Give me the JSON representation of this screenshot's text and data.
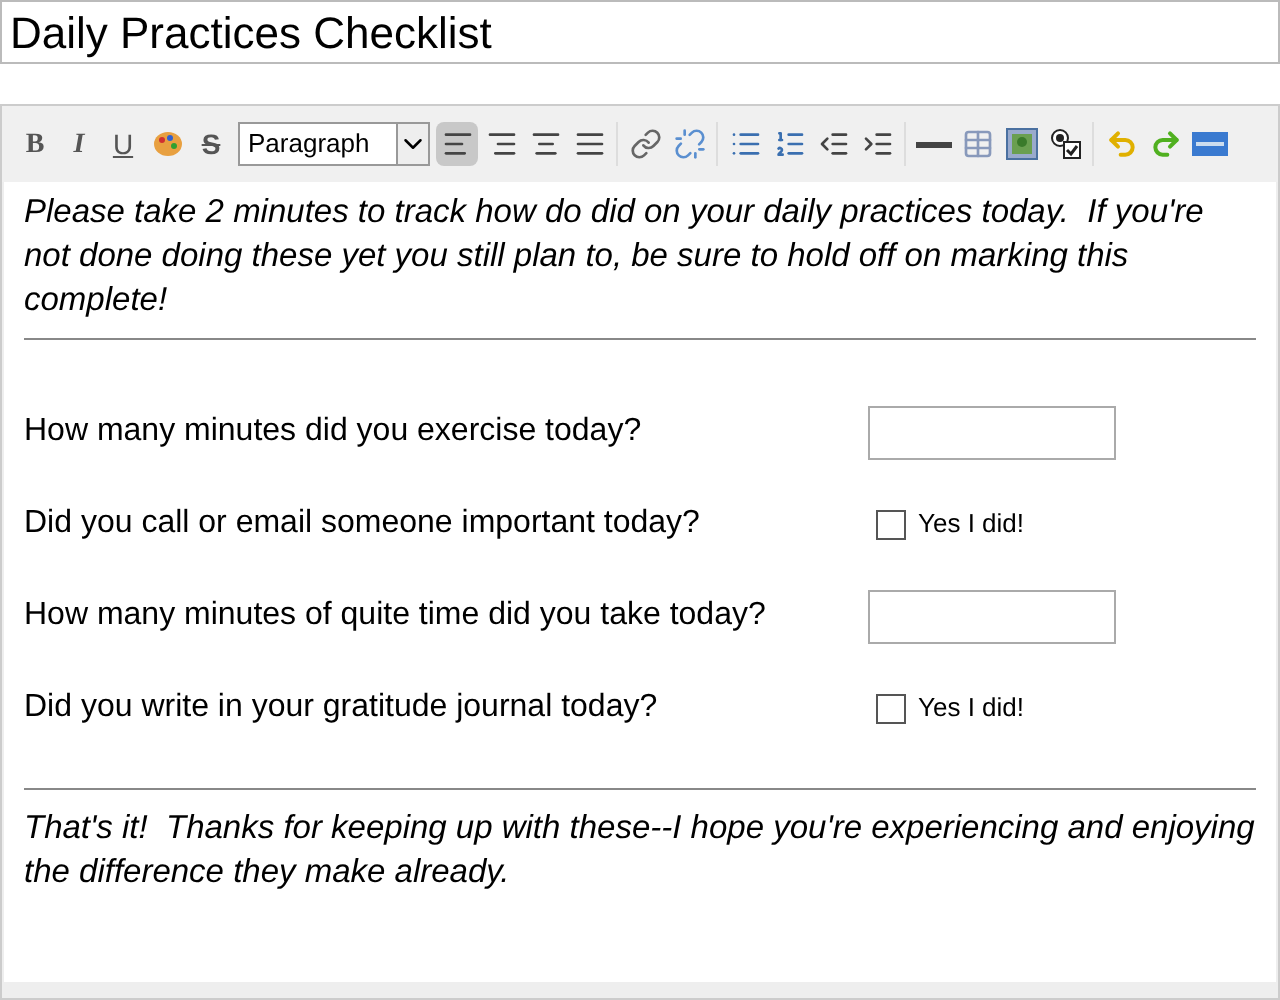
{
  "title_field": {
    "value": "Daily Practices Checklist"
  },
  "toolbar": {
    "groups": [
      [
        {
          "kind": "bold",
          "label": "B"
        },
        {
          "kind": "italic",
          "label": "I"
        },
        {
          "kind": "underline",
          "label": "U"
        },
        {
          "kind": "palette"
        },
        {
          "kind": "strike",
          "label": "S"
        },
        {
          "kind": "select",
          "value": "Paragraph"
        },
        {
          "kind": "align-left",
          "selected": true
        },
        {
          "kind": "align-right",
          "selected": false
        },
        {
          "kind": "align-center",
          "selected": false
        },
        {
          "kind": "align-justify",
          "selected": false
        }
      ],
      [
        {
          "kind": "link"
        },
        {
          "kind": "unlink"
        }
      ],
      [
        {
          "kind": "bullets"
        },
        {
          "kind": "numbers"
        },
        {
          "kind": "outdent"
        },
        {
          "kind": "indent"
        }
      ],
      [
        {
          "kind": "rule"
        },
        {
          "kind": "table"
        },
        {
          "kind": "image"
        },
        {
          "kind": "checkbox"
        }
      ],
      [
        {
          "kind": "undo"
        },
        {
          "kind": "redo"
        },
        {
          "kind": "html"
        }
      ]
    ]
  },
  "intro": "Please take 2 minutes to track how do did on your daily practices today.  If you're not done doing these yet you still plan to, be sure to hold off on marking this complete!",
  "questions": [
    {
      "kind": "number",
      "label": "How many minutes did you exercise today?"
    },
    {
      "kind": "checkbox",
      "label": "Did you call or email someone important today?",
      "option": "Yes I did!",
      "checked": false
    },
    {
      "kind": "number",
      "label": "How many minutes of quite time did you take today?"
    },
    {
      "kind": "checkbox",
      "label": "Did you write in your gratitude journal today?",
      "option": "Yes I did!",
      "checked": false
    }
  ],
  "outro": "That's it!  Thanks for keeping up with these--I hope you're experiencing and enjoying the difference they make already."
}
